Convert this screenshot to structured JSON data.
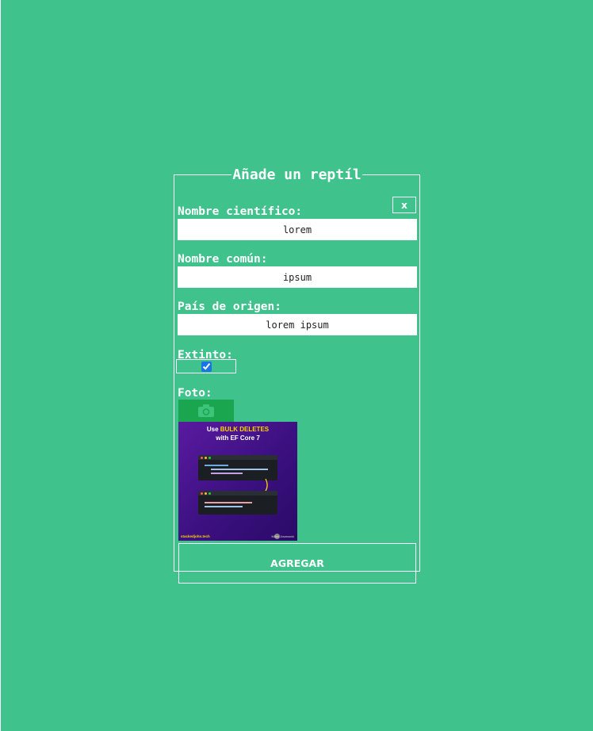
{
  "modal": {
    "title": "Añade un reptíl",
    "close_label": "x",
    "fields": {
      "scientific_name": {
        "label": "Nombre científico:",
        "value": "lorem"
      },
      "common_name": {
        "label": "Nombre común:",
        "value": "ipsum"
      },
      "country": {
        "label": "País de origen:",
        "value": "lorem ipsum"
      },
      "extinct": {
        "label": "Extinto:",
        "checked": true
      },
      "photo": {
        "label": "Foto:",
        "button_icon": "camera-icon"
      }
    },
    "preview": {
      "line1_prefix": "Use ",
      "line1_highlight": "BULK DELETES",
      "line2": "with EF Core 7",
      "footer_site": "stackedjohn.tech",
      "footer_author": "Milan Jovanović"
    },
    "submit_label": "AGREGAR"
  },
  "colors": {
    "background": "#3fc28c",
    "photo_button": "#1aa64e",
    "checkbox_accent": "#1a73e8"
  }
}
